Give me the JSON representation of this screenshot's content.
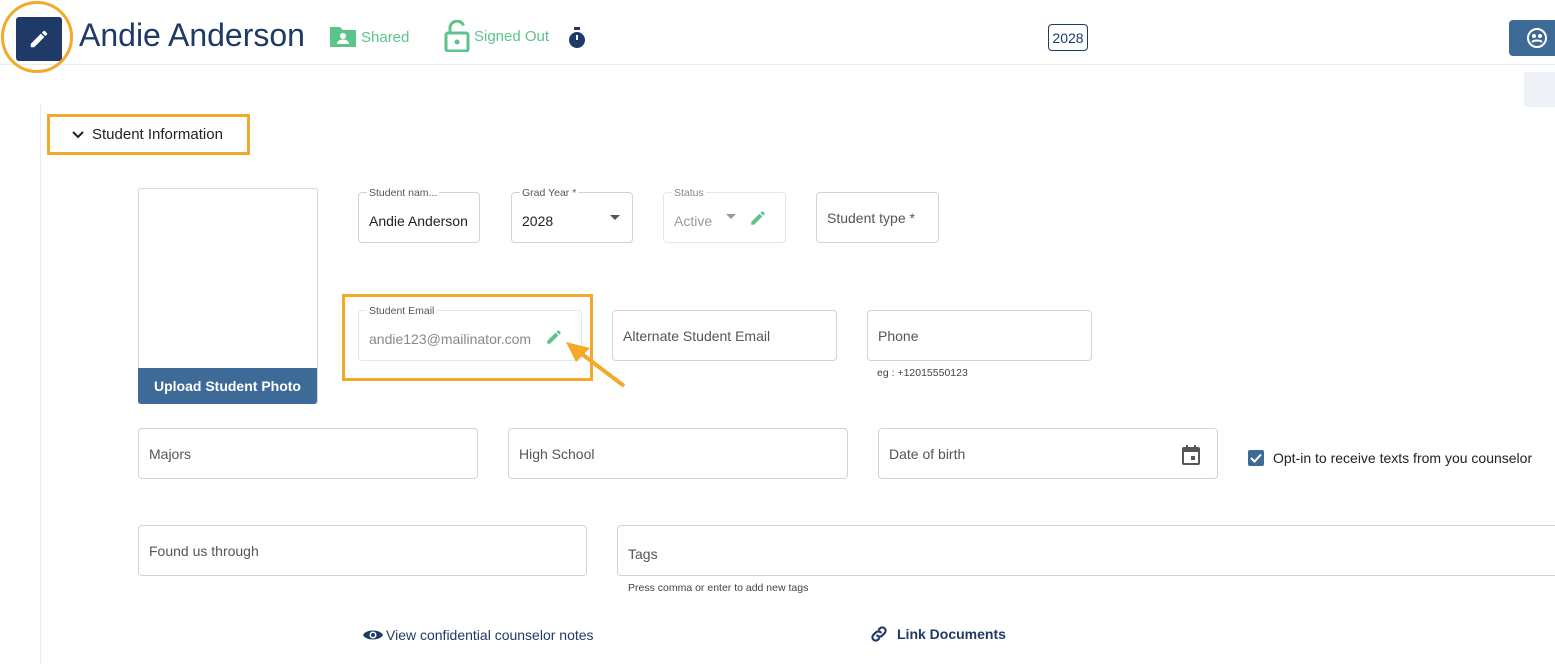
{
  "header": {
    "student_name": "Andie Anderson",
    "shared_label": "Shared",
    "signed_out_label": "Signed Out",
    "year_badge": "2028"
  },
  "section": {
    "title": "Student Information"
  },
  "photo": {
    "upload_label": "Upload Student Photo"
  },
  "fields": {
    "student_name": {
      "label": "Student nam...",
      "value": "Andie Anderson"
    },
    "grad_year": {
      "label": "Grad Year *",
      "value": "2028"
    },
    "status": {
      "label": "Status",
      "value": "Active"
    },
    "student_type": {
      "placeholder": "Student type *"
    },
    "student_email": {
      "label": "Student Email",
      "value": "andie123@mailinator.com"
    },
    "alternate_email": {
      "placeholder": "Alternate Student Email"
    },
    "phone": {
      "placeholder": "Phone",
      "hint": "eg : +12015550123"
    },
    "majors": {
      "placeholder": "Majors"
    },
    "high_school": {
      "placeholder": "High School"
    },
    "date_of_birth": {
      "placeholder": "Date of birth"
    },
    "found_us": {
      "placeholder": "Found us through"
    },
    "tags": {
      "placeholder": "Tags",
      "hint": "Press comma or enter to add new tags"
    }
  },
  "opt_in": {
    "label": "Opt-in to receive texts from you counselor",
    "checked": true
  },
  "links": {
    "confidential_notes": "View confidential counselor notes",
    "link_documents": "Link Documents"
  },
  "colors": {
    "navy": "#1f3a66",
    "steel_blue": "#3d6a96",
    "green": "#5cc48a",
    "highlight": "#f3a929"
  }
}
